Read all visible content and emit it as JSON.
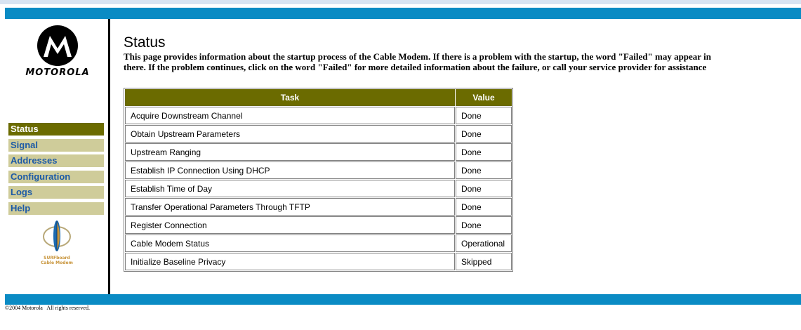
{
  "colors": {
    "accent_bar": "#0a8bc4",
    "header_olive": "#6b6b00",
    "nav_inactive": "#cfcc9a",
    "nav_text": "#1c5aa6"
  },
  "brand": {
    "logo_icon": "motorola-batwing-icon",
    "logo_text": "MOTOROLA",
    "surfboard_line1": "SURFboard",
    "surfboard_line2": "Cable Modem"
  },
  "nav": {
    "items": [
      {
        "label": "Status",
        "active": true
      },
      {
        "label": "Signal",
        "active": false
      },
      {
        "label": "Addresses",
        "active": false
      },
      {
        "label": "Configuration",
        "active": false
      },
      {
        "label": "Logs",
        "active": false
      },
      {
        "label": "Help",
        "active": false
      }
    ]
  },
  "main": {
    "title": "Status",
    "description_line1": "This page provides information about the startup process of the Cable Modem. If there is a problem with the startup, the word \"Failed\" may appear in",
    "description_line2": "there. If the problem continues, click on the word \"Failed\" for more detailed information about the failure, or call your service provider for assistance"
  },
  "table": {
    "headers": [
      "Task",
      "Value"
    ],
    "rows": [
      [
        "Acquire Downstream Channel",
        "Done"
      ],
      [
        "Obtain Upstream Parameters",
        "Done"
      ],
      [
        "Upstream Ranging",
        "Done"
      ],
      [
        "Establish IP Connection Using DHCP",
        "Done"
      ],
      [
        "Establish Time of Day",
        "Done"
      ],
      [
        "Transfer Operational Parameters Through TFTP",
        "Done"
      ],
      [
        "Register Connection",
        "Done"
      ],
      [
        "Cable Modem Status",
        "Operational"
      ],
      [
        "Initialize Baseline Privacy",
        "Skipped"
      ]
    ]
  },
  "footer": {
    "copyright": "©2004 Motorola   All rights reserved."
  }
}
